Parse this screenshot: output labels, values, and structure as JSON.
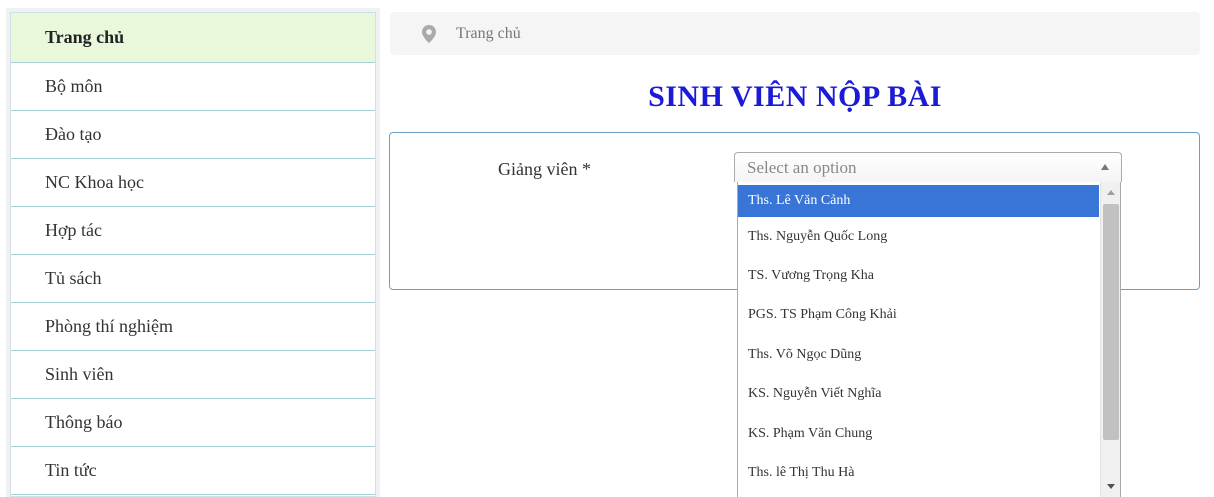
{
  "sidebar": {
    "items": [
      {
        "label": "Trang chủ",
        "active": true
      },
      {
        "label": "Bộ môn"
      },
      {
        "label": "Đào tạo"
      },
      {
        "label": "NC Khoa học"
      },
      {
        "label": "Hợp tác"
      },
      {
        "label": "Tủ sách"
      },
      {
        "label": "Phòng thí nghiệm"
      },
      {
        "label": "Sinh viên"
      },
      {
        "label": "Thông báo"
      },
      {
        "label": "Tin tức"
      }
    ]
  },
  "breadcrumb": {
    "icon": "map-pin-icon",
    "label": "Trang chủ"
  },
  "page": {
    "title": "SINH VIÊN NỘP BÀI"
  },
  "form": {
    "lecturer_label": "Giảng viên *",
    "lecturer_select": {
      "placeholder": "Select an option",
      "options": [
        "Ths. Lê Văn Cảnh",
        "Ths. Nguyễn Quốc Long",
        "TS. Vương Trọng Kha",
        "PGS. TS Phạm Công Khải",
        "Ths. Võ Ngọc Dũng",
        "KS. Nguyễn Viết Nghĩa",
        "KS. Phạm Văn Chung",
        "Ths. lê Thị Thu Hà"
      ],
      "highlighted_index": 0
    }
  },
  "colors": {
    "title": "#1b1bd6",
    "highlight": "#3875d7",
    "sidebar_active": "#e9f8db",
    "panel_border": "#6aa0c8"
  }
}
